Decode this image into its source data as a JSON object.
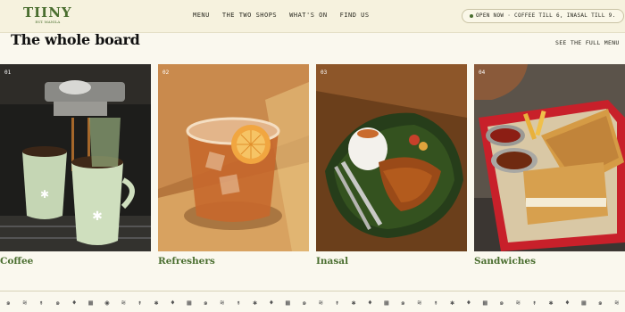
{
  "header": {
    "logo_text": "TIINY",
    "logo_subtext": "EST. MANILA",
    "nav": [
      "MENU",
      "THE TWO SHOPS",
      "WHAT'S ON",
      "FIND US"
    ],
    "status": "OPEN NOW · COFFEE TILL 6, INASAL TILL 9."
  },
  "section": {
    "title": "The whole board",
    "see_all": "SEE THE FULL MENU"
  },
  "cards": [
    {
      "num": "01",
      "name": "Coffee"
    },
    {
      "num": "02",
      "name": "Refreshers"
    },
    {
      "num": "03",
      "name": "Inasal"
    },
    {
      "num": "04",
      "name": "Sandwiches"
    }
  ],
  "footer": {
    "icons": [
      "spiral-icon",
      "wave-icon",
      "palm-icon",
      "spiral-icon",
      "leaf-icon",
      "grid-icon",
      "coffee-icon",
      "wave-icon",
      "palm-icon",
      "sun-icon",
      "leaf-icon",
      "grid-icon",
      "spiral-icon",
      "wave-icon",
      "palm-icon",
      "sun-icon",
      "leaf-icon",
      "grid-icon",
      "spiral-icon",
      "wave-icon",
      "palm-icon",
      "sun-icon",
      "leaf-icon",
      "grid-icon",
      "spiral-icon",
      "wave-icon",
      "palm-icon",
      "sun-icon",
      "leaf-icon",
      "grid-icon",
      "spiral-icon",
      "wave-icon",
      "palm-icon",
      "sun-icon",
      "leaf-icon",
      "grid-icon",
      "spiral-icon",
      "wave-icon"
    ]
  },
  "colors": {
    "brand_green": "#4a6e2f",
    "cream": "#faf8ee"
  }
}
